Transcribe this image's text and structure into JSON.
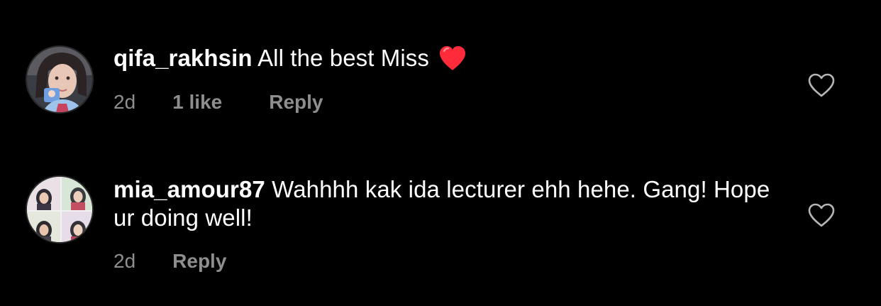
{
  "comments": [
    {
      "username": "qifa_rakhsin",
      "text": "All the best Miss",
      "emoji": "heart-emoji",
      "time": "2d",
      "likes": "1 like",
      "reply_label": "Reply",
      "like_icon": "heart-outline-icon"
    },
    {
      "username": "mia_amour87",
      "text": "Wahhhh kak ida lecturer ehh hehe. Gang! Hope ur doing well!",
      "time": "2d",
      "reply_label": "Reply",
      "like_icon": "heart-outline-icon"
    }
  ],
  "colors": {
    "background": "#000000",
    "text": "#ffffff",
    "meta": "#8e8e8e",
    "heart_emoji": "#ff2a3a"
  }
}
